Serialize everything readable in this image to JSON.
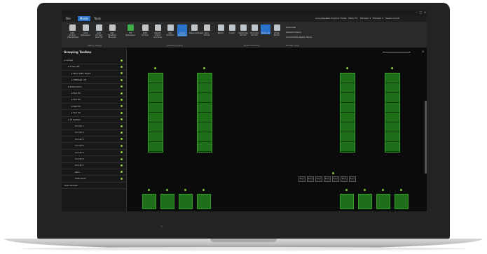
{
  "menu": {
    "file": "File",
    "model": "Model",
    "tools": "Tools"
  },
  "top_right": {
    "items": [
      "Array/Speaker Explorer",
      "Probe",
      "Meter FX",
      "Element 1",
      "Element 3",
      "Space mount"
    ]
  },
  "ribbon": {
    "buttons": [
      "Add Arrays (Template)",
      "Add Speakers",
      "Add Arrays and Fill",
      "Set Speaker Mounts",
      "Fit Speakers",
      "Edit Arrays",
      "Select Input Sources",
      "Set System",
      "Save Systems",
      "Measurement",
      "Run Show",
      "Parity",
      "Load",
      "Calibrate all Sel",
      "Unmute all Sel",
      "Mute All",
      "Mute Mode"
    ],
    "groups": [
      "Offline Usage",
      "System Control",
      "Mute Functions",
      "Display View"
    ],
    "view_options": [
      "Overview",
      "Detailed Panel",
      "Consolidate Ready Panel"
    ]
  },
  "sidebar": {
    "title": "Grouping Toolbox",
    "items": [
      {
        "label": "Arrays",
        "indent": 0
      },
      {
        "label": "Array (M)",
        "indent": 1
      },
      {
        "label": "Main Left / Right",
        "indent": 2
      },
      {
        "label": "Offstage L/R",
        "indent": 2
      },
      {
        "label": "Subwoofers",
        "indent": 1
      },
      {
        "label": "Sub S1",
        "indent": 2
      },
      {
        "label": "Sub S2",
        "indent": 2
      },
      {
        "label": "Sub S3",
        "indent": 2
      },
      {
        "label": "Sub S4",
        "indent": 2
      },
      {
        "label": "All System",
        "indent": 1
      },
      {
        "label": "Circuit 1",
        "indent": 3
      },
      {
        "label": "Circuit 2",
        "indent": 3
      },
      {
        "label": "Circuit 3",
        "indent": 3
      },
      {
        "label": "Circuit 4",
        "indent": 3
      },
      {
        "label": "Circuit 5",
        "indent": 3
      },
      {
        "label": "Circuit 6",
        "indent": 3
      },
      {
        "label": "Circuit 7",
        "indent": 3
      },
      {
        "label": "Fans",
        "indent": 3
      },
      {
        "label": "Side Input",
        "indent": 3
      },
      {
        "label": "User Groups",
        "indent": 0
      }
    ]
  },
  "canvas": {
    "amp_labels": [
      "Amp 1",
      "Amp 2",
      "Amp 3",
      "Amp 4",
      "Amp 5",
      "Amp 6",
      "Amp 7"
    ]
  },
  "colors": {
    "accent": "#2a73c8",
    "green": "#3fae49",
    "status_dot": "#8cc63f"
  }
}
